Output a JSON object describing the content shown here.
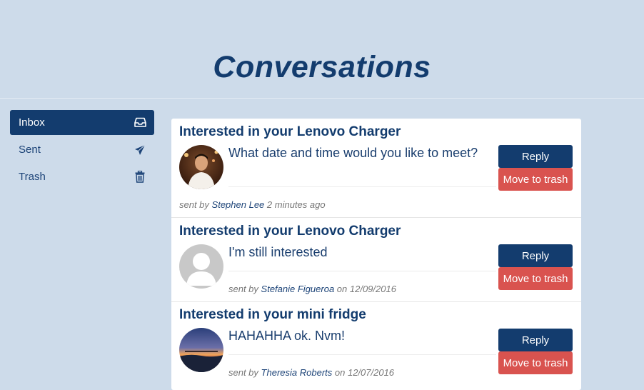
{
  "header": {
    "title": "Conversations"
  },
  "sidebar": {
    "items": [
      {
        "label": "Inbox",
        "icon": "inbox-icon",
        "active": true
      },
      {
        "label": "Sent",
        "icon": "paper-plane-icon",
        "active": false
      },
      {
        "label": "Trash",
        "icon": "trash-icon",
        "active": false
      }
    ]
  },
  "conversations": [
    {
      "subject": "Interested in your Lenovo Charger",
      "message": "What date and time would you like to meet?",
      "sent_by_prefix": "sent by",
      "sender": "Stephen Lee",
      "time": "2 minutes ago",
      "avatar": "photo",
      "reply_label": "Reply",
      "trash_label": "Move to trash"
    },
    {
      "subject": "Interested in your Lenovo Charger",
      "message": "I'm still interested",
      "sent_by_prefix": "sent by",
      "sender": "Stefanie Figueroa",
      "time": "on 12/09/2016",
      "avatar": "default",
      "reply_label": "Reply",
      "trash_label": "Move to trash"
    },
    {
      "subject": "Interested in your mini fridge",
      "message": "HAHAHHA ok. Nvm!",
      "sent_by_prefix": "sent by",
      "sender": "Theresia Roberts",
      "time": "on 12/07/2016",
      "avatar": "sunset",
      "reply_label": "Reply",
      "trash_label": "Move to trash"
    }
  ],
  "colors": {
    "background": "#cddbea",
    "primary": "#133c6e",
    "danger": "#d9534f"
  }
}
